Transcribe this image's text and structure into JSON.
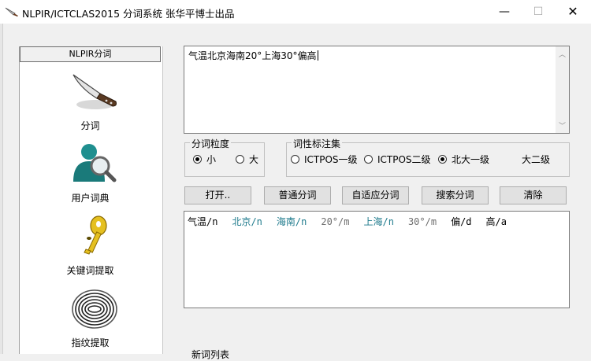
{
  "window": {
    "title": "NLPIR/ICTCLAS2015 分词系统 张华平博士出品"
  },
  "sidebar": {
    "header": "NLPIR分词",
    "items": [
      {
        "label": "分词",
        "icon": "knife-icon"
      },
      {
        "label": "用户词典",
        "icon": "user-search-icon"
      },
      {
        "label": "关键词提取",
        "icon": "key-icon"
      },
      {
        "label": "指纹提取",
        "icon": "fingerprint-icon"
      }
    ]
  },
  "input": {
    "text": "气温北京海南20°上海30°偏高"
  },
  "granularity": {
    "title": "分词粒度",
    "options": [
      {
        "label": "小",
        "selected": true
      },
      {
        "label": "大",
        "selected": false
      }
    ]
  },
  "pos_set": {
    "title": "词性标注集",
    "options": [
      {
        "label": "ICTPOS一级",
        "selected": false
      },
      {
        "label": "ICTPOS二级",
        "selected": false
      },
      {
        "label": "北大一级",
        "selected": true
      },
      {
        "label": "大二级",
        "selected": false
      }
    ]
  },
  "buttons": {
    "open": "打开..",
    "normal": "普通分词",
    "adaptive": "自适应分词",
    "search": "搜索分词",
    "clear": "清除"
  },
  "output": {
    "tokens": [
      {
        "text": "气温/n",
        "color": "#000000"
      },
      {
        "text": "北京/n",
        "color": "#1e7a8c"
      },
      {
        "text": "海南/n",
        "color": "#1e7a8c"
      },
      {
        "text": "20°/m",
        "color": "#6e6e6e"
      },
      {
        "text": "上海/n",
        "color": "#1e7a8c"
      },
      {
        "text": "30°/m",
        "color": "#6e6e6e"
      },
      {
        "text": "偏/d",
        "color": "#000000"
      },
      {
        "text": "高/a",
        "color": "#000000"
      }
    ]
  },
  "newword_list": {
    "label": "新词列表"
  }
}
